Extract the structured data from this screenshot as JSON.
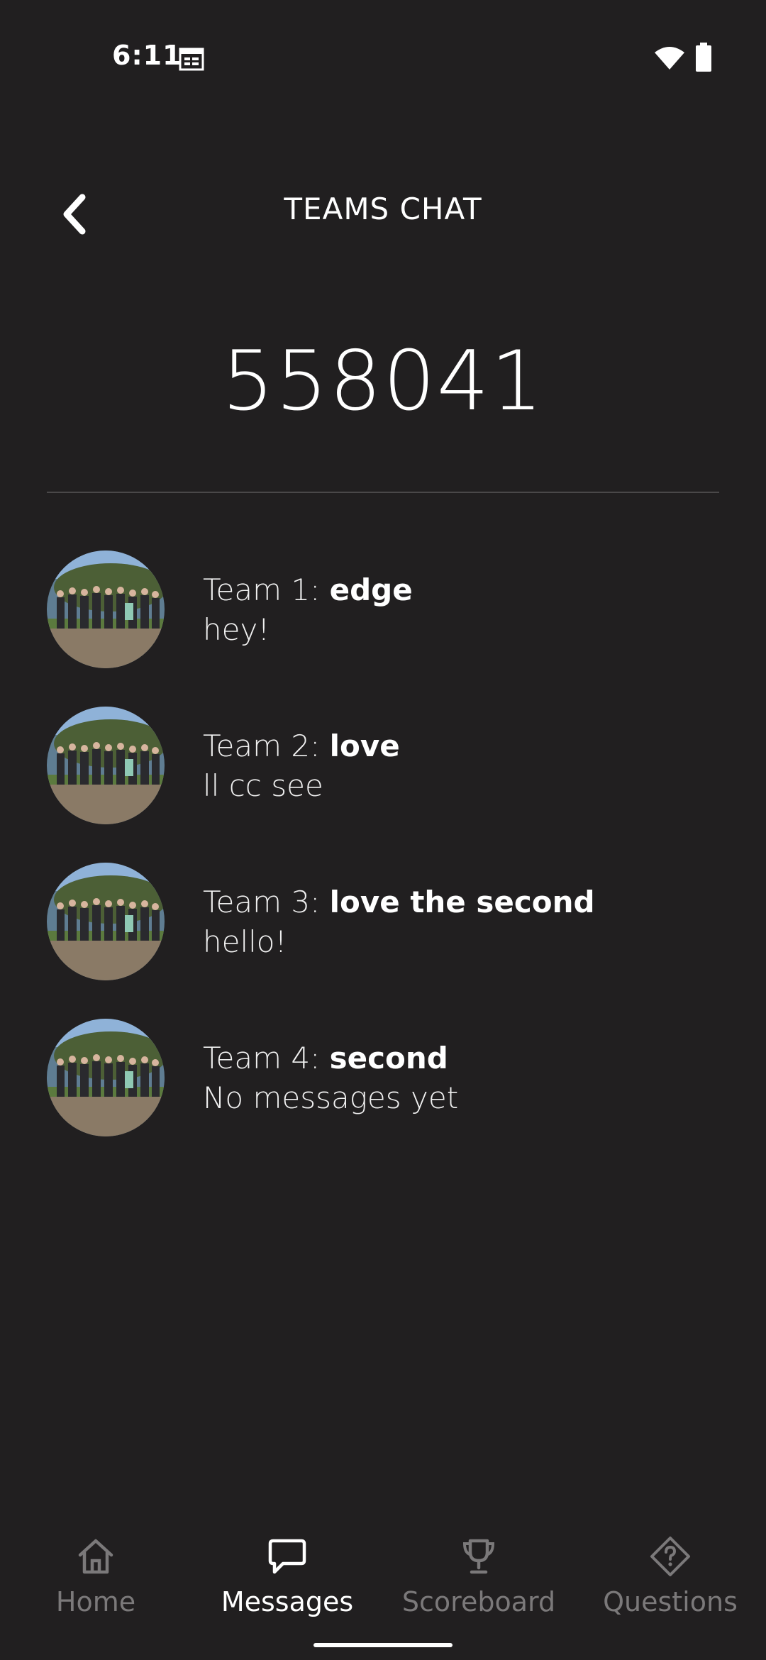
{
  "status_bar": {
    "time": "6:11"
  },
  "header": {
    "title": "TEAMS CHAT"
  },
  "room": {
    "code": "558041"
  },
  "teams": [
    {
      "prefix": "Team 1: ",
      "name": "edge",
      "last_message": "hey!"
    },
    {
      "prefix": "Team 2: ",
      "name": "love",
      "last_message": "ll cc see"
    },
    {
      "prefix": "Team 3: ",
      "name": "love the second",
      "last_message": "hello!"
    },
    {
      "prefix": "Team 4: ",
      "name": "second",
      "last_message": "No messages yet"
    }
  ],
  "nav": {
    "home": "Home",
    "messages": "Messages",
    "scoreboard": "Scoreboard",
    "questions": "Questions"
  },
  "colors": {
    "background": "#211f20",
    "active": "#ffffff",
    "inactive": "#7b797a"
  }
}
